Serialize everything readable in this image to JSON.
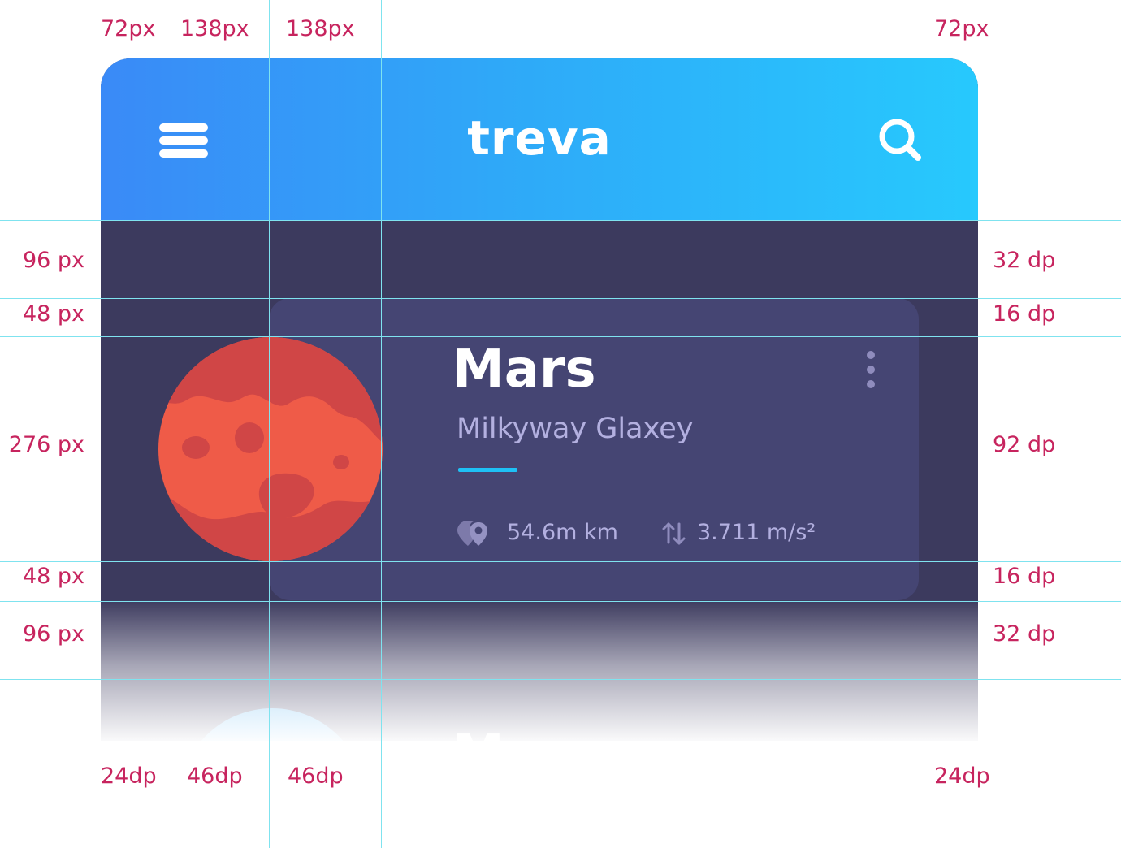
{
  "app_bar": {
    "title": "treva",
    "gradient_colors": [
      "#3a8af7",
      "#27c9fd"
    ],
    "menu_icon": "hamburger-menu-icon",
    "search_icon": "search-icon"
  },
  "planet_card": {
    "name": "Mars",
    "subtitle": "Milkyway Glaxey",
    "accent_color": "#1ec1f6",
    "stats": [
      {
        "icon": "map-pins-icon",
        "value": "54.6m km"
      },
      {
        "icon": "gravity-arrows-icon",
        "value": "3.711 m/s²"
      }
    ],
    "more_icon": "more-vertical-icon"
  },
  "next_card_peek": {
    "title_fragment": "M"
  },
  "spec_labels": {
    "top": [
      "72px",
      "138px",
      "138px",
      "72px"
    ],
    "bottom": [
      "24dp",
      "46dp",
      "46dp",
      "24dp"
    ],
    "left": [
      "96 px",
      "48 px",
      "276 px",
      "48 px",
      "96 px"
    ],
    "right": [
      "32 dp",
      "16 dp",
      "92 dp",
      "16 dp",
      "32 dp"
    ]
  },
  "colors": {
    "background": "#3c3a5e",
    "card": "#454573",
    "spec_text": "#c7245e",
    "guide_line": "#7fe3ef",
    "planet": "#ef5b48",
    "planet_shade": "#d04646"
  }
}
